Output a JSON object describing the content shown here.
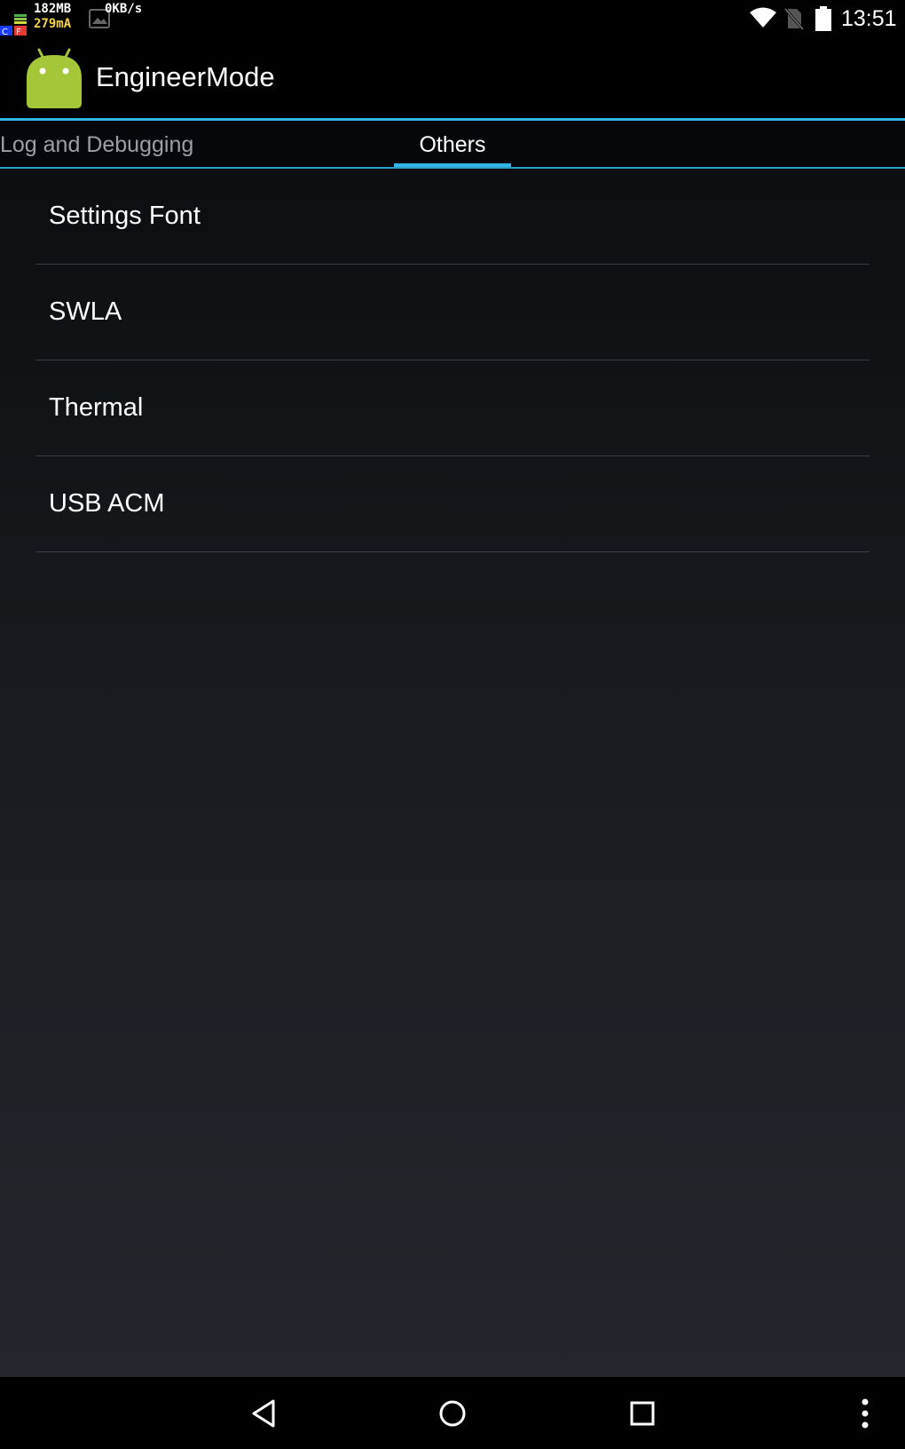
{
  "status_bar": {
    "memory": "182MB",
    "current": "279mA",
    "net_speed": "0KB/s",
    "time": "13:51",
    "icons": [
      "monitor-icon",
      "image-notification-icon",
      "wifi-icon",
      "no-sim-icon",
      "battery-icon"
    ]
  },
  "action_bar": {
    "title": "EngineerMode",
    "icon": "android-icon"
  },
  "tabs": [
    {
      "label": "Log and Debugging",
      "selected": false
    },
    {
      "label": "Others",
      "selected": true
    }
  ],
  "list": {
    "items": [
      {
        "label": "Settings Font"
      },
      {
        "label": "SWLA"
      },
      {
        "label": "Thermal"
      },
      {
        "label": "USB ACM"
      }
    ]
  },
  "nav_bar": {
    "icons": [
      "back-icon",
      "home-icon",
      "recents-icon",
      "overflow-menu-icon"
    ]
  },
  "colors": {
    "accent": "#33b5e5",
    "android_green": "#a4c639",
    "current_text": "#f5d44a"
  }
}
